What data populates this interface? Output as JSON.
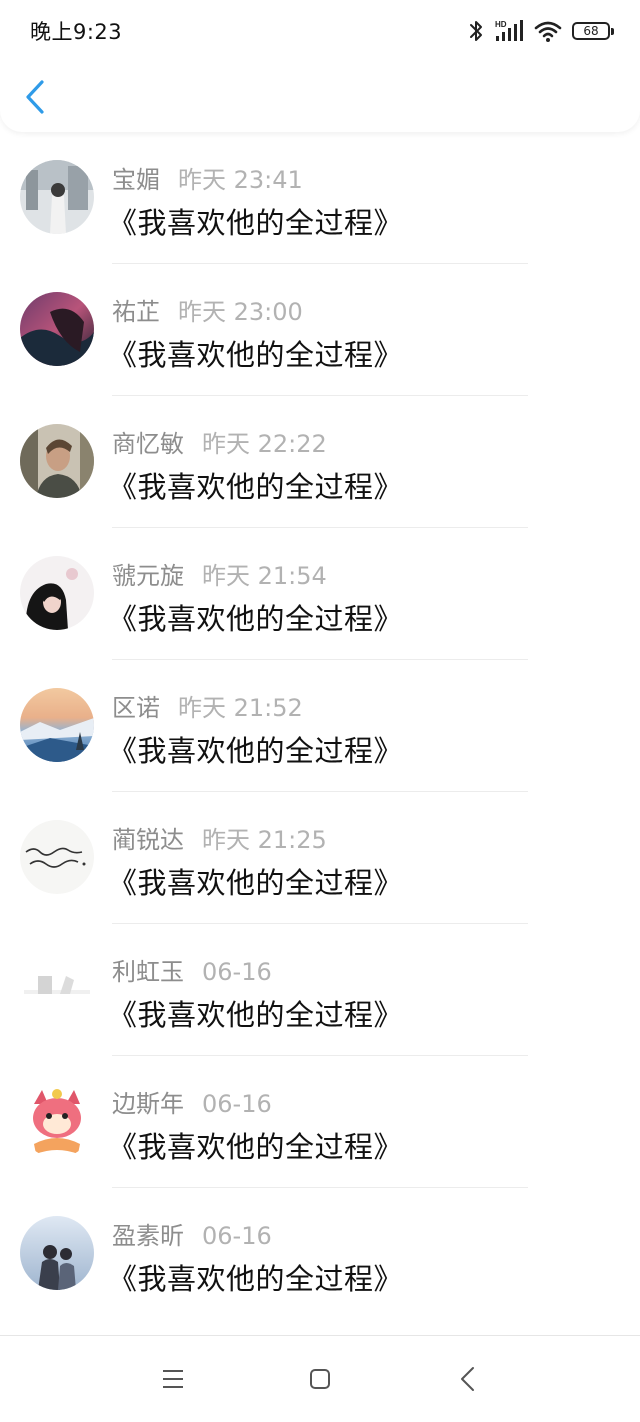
{
  "status_bar": {
    "time": "晚上9:23",
    "battery": "68",
    "icons": [
      "bluetooth-icon",
      "hd-signal-icon",
      "wifi-icon",
      "battery-icon"
    ]
  },
  "header": {
    "back_icon": "chevron-left-icon",
    "accent_color": "#2f9be8"
  },
  "items": [
    {
      "name": "宝媚",
      "time": "昨天 23:41",
      "title": "《我喜欢他的全过程》"
    },
    {
      "name": "祐芷",
      "time": "昨天 23:00",
      "title": "《我喜欢他的全过程》"
    },
    {
      "name": "商忆敏",
      "time": "昨天 22:22",
      "title": "《我喜欢他的全过程》"
    },
    {
      "name": "虢元旋",
      "time": "昨天 21:54",
      "title": "《我喜欢他的全过程》"
    },
    {
      "name": "区诺",
      "time": "昨天 21:52",
      "title": "《我喜欢他的全过程》"
    },
    {
      "name": "蔺锐达",
      "time": "昨天 21:25",
      "title": "《我喜欢他的全过程》"
    },
    {
      "name": "利虹玉",
      "time": "06-16",
      "title": "《我喜欢他的全过程》"
    },
    {
      "name": "边斯年",
      "time": "06-16",
      "title": "《我喜欢他的全过程》"
    },
    {
      "name": "盈素昕",
      "time": "06-16",
      "title": "《我喜欢他的全过程》"
    }
  ],
  "nav_bar": {
    "icons": [
      "menu-icon",
      "home-square-icon",
      "back-triangle-icon"
    ]
  }
}
